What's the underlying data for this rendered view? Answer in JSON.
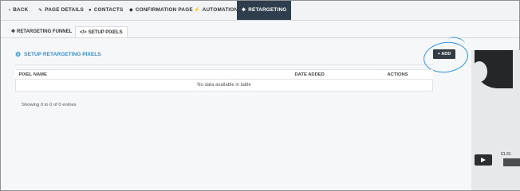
{
  "nav": {
    "tabs": [
      {
        "icon": "‹",
        "label": "BACK"
      },
      {
        "icon": "∿",
        "label": "PAGE DETAILS"
      },
      {
        "icon": "●",
        "label": "CONTACTS"
      },
      {
        "icon": "◆",
        "label": "CONFIRMATION PAGE"
      },
      {
        "icon": "⚡",
        "label": "AUTOMATION"
      },
      {
        "icon": "✥",
        "label": "RETARGETING"
      }
    ],
    "active_index": 5
  },
  "subtabs": [
    {
      "icon": "✥",
      "label": "RETARGETING FUNNEL"
    },
    {
      "icon": "</>",
      "label": "SETUP PIXELS"
    }
  ],
  "section": {
    "title": "SETUP RETARGETING PIXELS",
    "icon": "cogs-icon",
    "add_label": "+ ADD"
  },
  "table": {
    "headers": [
      "PIXEL NAME",
      "DATE ADDED",
      "ACTIONS"
    ],
    "empty_text": "No data available in table"
  },
  "entries_info": "Showing 0 to 0 of 0 entries",
  "video": {
    "time": "01:31"
  },
  "colors": {
    "accent": "#3c8dcb",
    "nav_active": "#2f3e4c",
    "button": "#333c45",
    "annotation": "#2e93d6"
  }
}
